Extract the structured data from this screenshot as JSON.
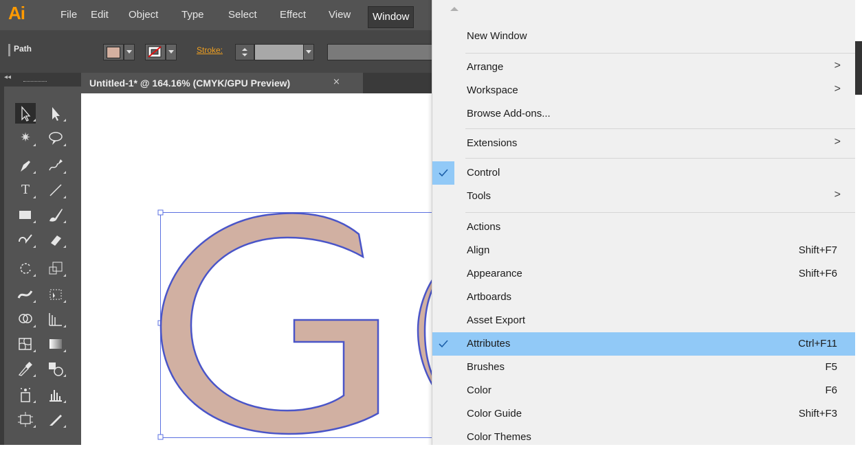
{
  "app": {
    "logo": "Ai"
  },
  "menubar": [
    "File",
    "Edit",
    "Object",
    "Type",
    "Select",
    "Effect",
    "View",
    "Window"
  ],
  "control": {
    "selection_type": "Path",
    "stroke_label": "Stroke:",
    "fill_color": "#d4b0a0"
  },
  "document": {
    "tab_title": "Untitled-1* @ 164.16% (CMYK/GPU Preview)",
    "close": "×",
    "glyph_fill": "#d1b0a2",
    "glyph_stroke": "#4a55c8"
  },
  "window_menu": {
    "items": [
      {
        "label": "New Window",
        "shortcut": "",
        "submenu": false,
        "checked": false
      },
      {
        "label": "Arrange",
        "shortcut": "",
        "submenu": true,
        "checked": false
      },
      {
        "label": "Workspace",
        "shortcut": "",
        "submenu": true,
        "checked": false
      },
      {
        "label": "Browse Add-ons...",
        "shortcut": "",
        "submenu": false,
        "checked": false
      },
      {
        "label": "Extensions",
        "shortcut": "",
        "submenu": true,
        "checked": false
      },
      {
        "label": "Control",
        "shortcut": "",
        "submenu": false,
        "checked": true
      },
      {
        "label": "Tools",
        "shortcut": "",
        "submenu": true,
        "checked": false
      },
      {
        "label": "Actions",
        "shortcut": "",
        "submenu": false,
        "checked": false
      },
      {
        "label": "Align",
        "shortcut": "Shift+F7",
        "submenu": false,
        "checked": false
      },
      {
        "label": "Appearance",
        "shortcut": "Shift+F6",
        "submenu": false,
        "checked": false
      },
      {
        "label": "Artboards",
        "shortcut": "",
        "submenu": false,
        "checked": false
      },
      {
        "label": "Asset Export",
        "shortcut": "",
        "submenu": false,
        "checked": false
      },
      {
        "label": "Attributes",
        "shortcut": "Ctrl+F11",
        "submenu": false,
        "checked": true,
        "highlighted": true
      },
      {
        "label": "Brushes",
        "shortcut": "F5",
        "submenu": false,
        "checked": false
      },
      {
        "label": "Color",
        "shortcut": "F6",
        "submenu": false,
        "checked": false
      },
      {
        "label": "Color Guide",
        "shortcut": "Shift+F3",
        "submenu": false,
        "checked": false
      },
      {
        "label": "Color Themes",
        "shortcut": "",
        "submenu": false,
        "checked": false
      }
    ],
    "submenu_arrow": ">",
    "highlight_color": "#91c9f7"
  },
  "tools": [
    "selection-tool",
    "direct-selection-tool",
    "magic-wand-tool",
    "lasso-tool",
    "pen-tool",
    "curvature-tool",
    "type-tool",
    "line-segment-tool",
    "rectangle-tool",
    "paintbrush-tool",
    "shaper-tool",
    "eraser-tool",
    "rotate-tool",
    "scale-tool",
    "width-tool",
    "free-transform-tool",
    "shape-builder-tool",
    "perspective-grid-tool",
    "mesh-tool",
    "gradient-tool",
    "eyedropper-tool",
    "blend-tool",
    "symbol-sprayer-tool",
    "column-graph-tool",
    "artboard-tool",
    "slice-tool"
  ]
}
